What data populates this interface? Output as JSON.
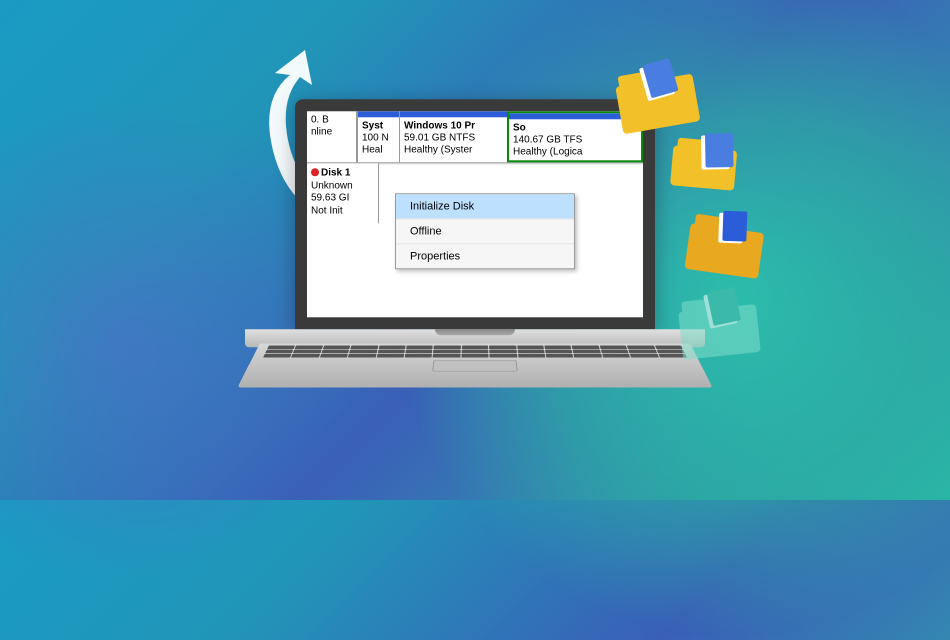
{
  "disk0": {
    "left": {
      "size": "0. B",
      "status": "nline"
    },
    "partitions": [
      {
        "title": "Syst",
        "line2": "100 N",
        "line3": "Heal"
      },
      {
        "title": "Windows 10 Pr",
        "line2": "59.01 GB NTFS",
        "line3": "Healthy (Syster"
      },
      {
        "title": "So",
        "line2": "140.67 GB TFS",
        "line3": "Healthy (Logica"
      }
    ]
  },
  "disk1": {
    "name": "Disk 1",
    "type": "Unknown",
    "size": "59.63 GI",
    "status": "Not Init"
  },
  "context_menu": {
    "items": [
      {
        "label": "Initialize Disk",
        "highlighted": true
      },
      {
        "label": "Offline",
        "highlighted": false
      },
      {
        "label": "Properties",
        "highlighted": false
      }
    ]
  }
}
